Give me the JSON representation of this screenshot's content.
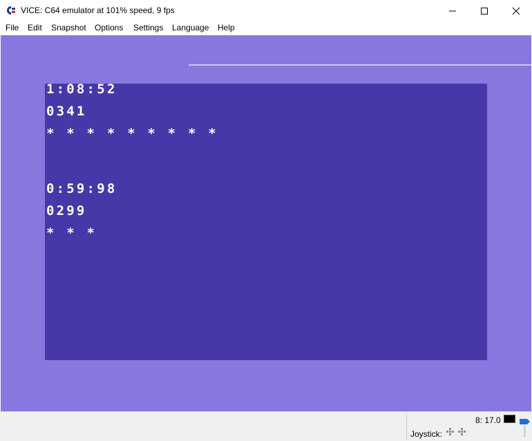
{
  "window": {
    "title": "VICE: C64 emulator at 101% speed, 9 fps",
    "app_icon": "commodore-logo-icon"
  },
  "menu": {
    "items": [
      "File",
      "Edit",
      "Snapshot",
      "Options",
      "Settings",
      "Language",
      "Help"
    ]
  },
  "screen": {
    "lines": [
      "1:08:52",
      "0341",
      "* * * * * * * * *",
      "0:59:98",
      "0299",
      "* * *"
    ],
    "colors": {
      "screen": "#4638a8",
      "border": "#8877de",
      "text": "#ffffff"
    }
  },
  "status": {
    "joystick_label": "Joystick:",
    "drive_status": "8: 17.0",
    "icons": [
      "joystick-port1-icon",
      "joystick-port2-icon",
      "drive-led-icon",
      "tape-icon"
    ]
  }
}
